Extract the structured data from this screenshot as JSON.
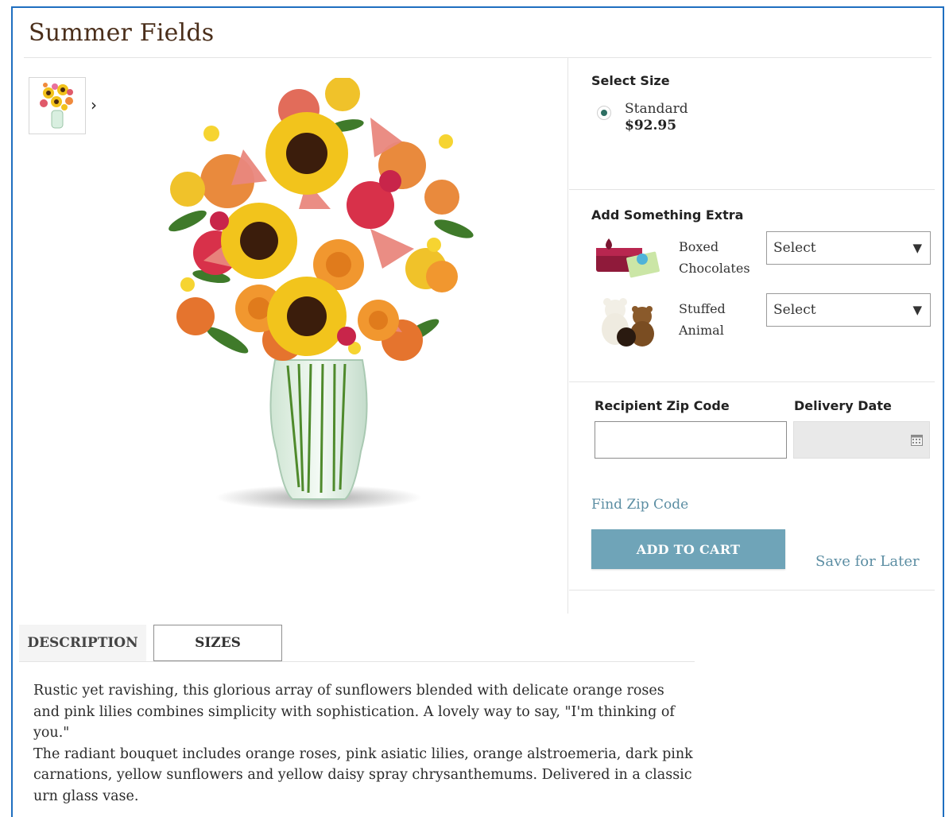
{
  "product": {
    "title": "Summer Fields"
  },
  "size": {
    "heading": "Select Size",
    "option": {
      "name": "Standard",
      "price": "$92.95",
      "selected": true
    }
  },
  "extras": {
    "heading": "Add Something Extra",
    "items": [
      {
        "label_line1": "Boxed",
        "label_line2": "Chocolates",
        "select_value": "Select"
      },
      {
        "label_line1": "Stuffed",
        "label_line2": "Animal",
        "select_value": "Select"
      }
    ]
  },
  "delivery": {
    "zip_label": "Recipient Zip Code",
    "zip_value": "",
    "date_label": "Delivery Date",
    "date_value": ""
  },
  "actions": {
    "find_zip": "Find Zip Code",
    "add_to_cart": "ADD TO CART",
    "save_for_later": "Save for Later"
  },
  "tabs": [
    {
      "label": "DESCRIPTION",
      "active": false
    },
    {
      "label": "SIZES",
      "active": true
    }
  ],
  "description": {
    "p1": "Rustic yet ravishing, this glorious array of sunflowers blended with delicate orange roses and pink lilies combines simplicity with sophistication. A lovely way to say, \"I'm thinking of you.\"",
    "p2": "The radiant bouquet includes orange roses, pink asiatic lilies, orange alstroemeria, dark pink carnations, yellow sunflowers and yellow daisy spray chrysanthemums. Delivered in a classic urn glass vase."
  },
  "colors": {
    "accent": "#6fa4b8",
    "link": "#5c8ea3",
    "title": "#4a2e1a",
    "radio": "#2e6f63",
    "border": "#1f6fc0"
  },
  "icons": {
    "thumbnail_next": "chevron-right-icon",
    "select_arrow": "triangle-down-icon",
    "date": "calendar-icon"
  }
}
